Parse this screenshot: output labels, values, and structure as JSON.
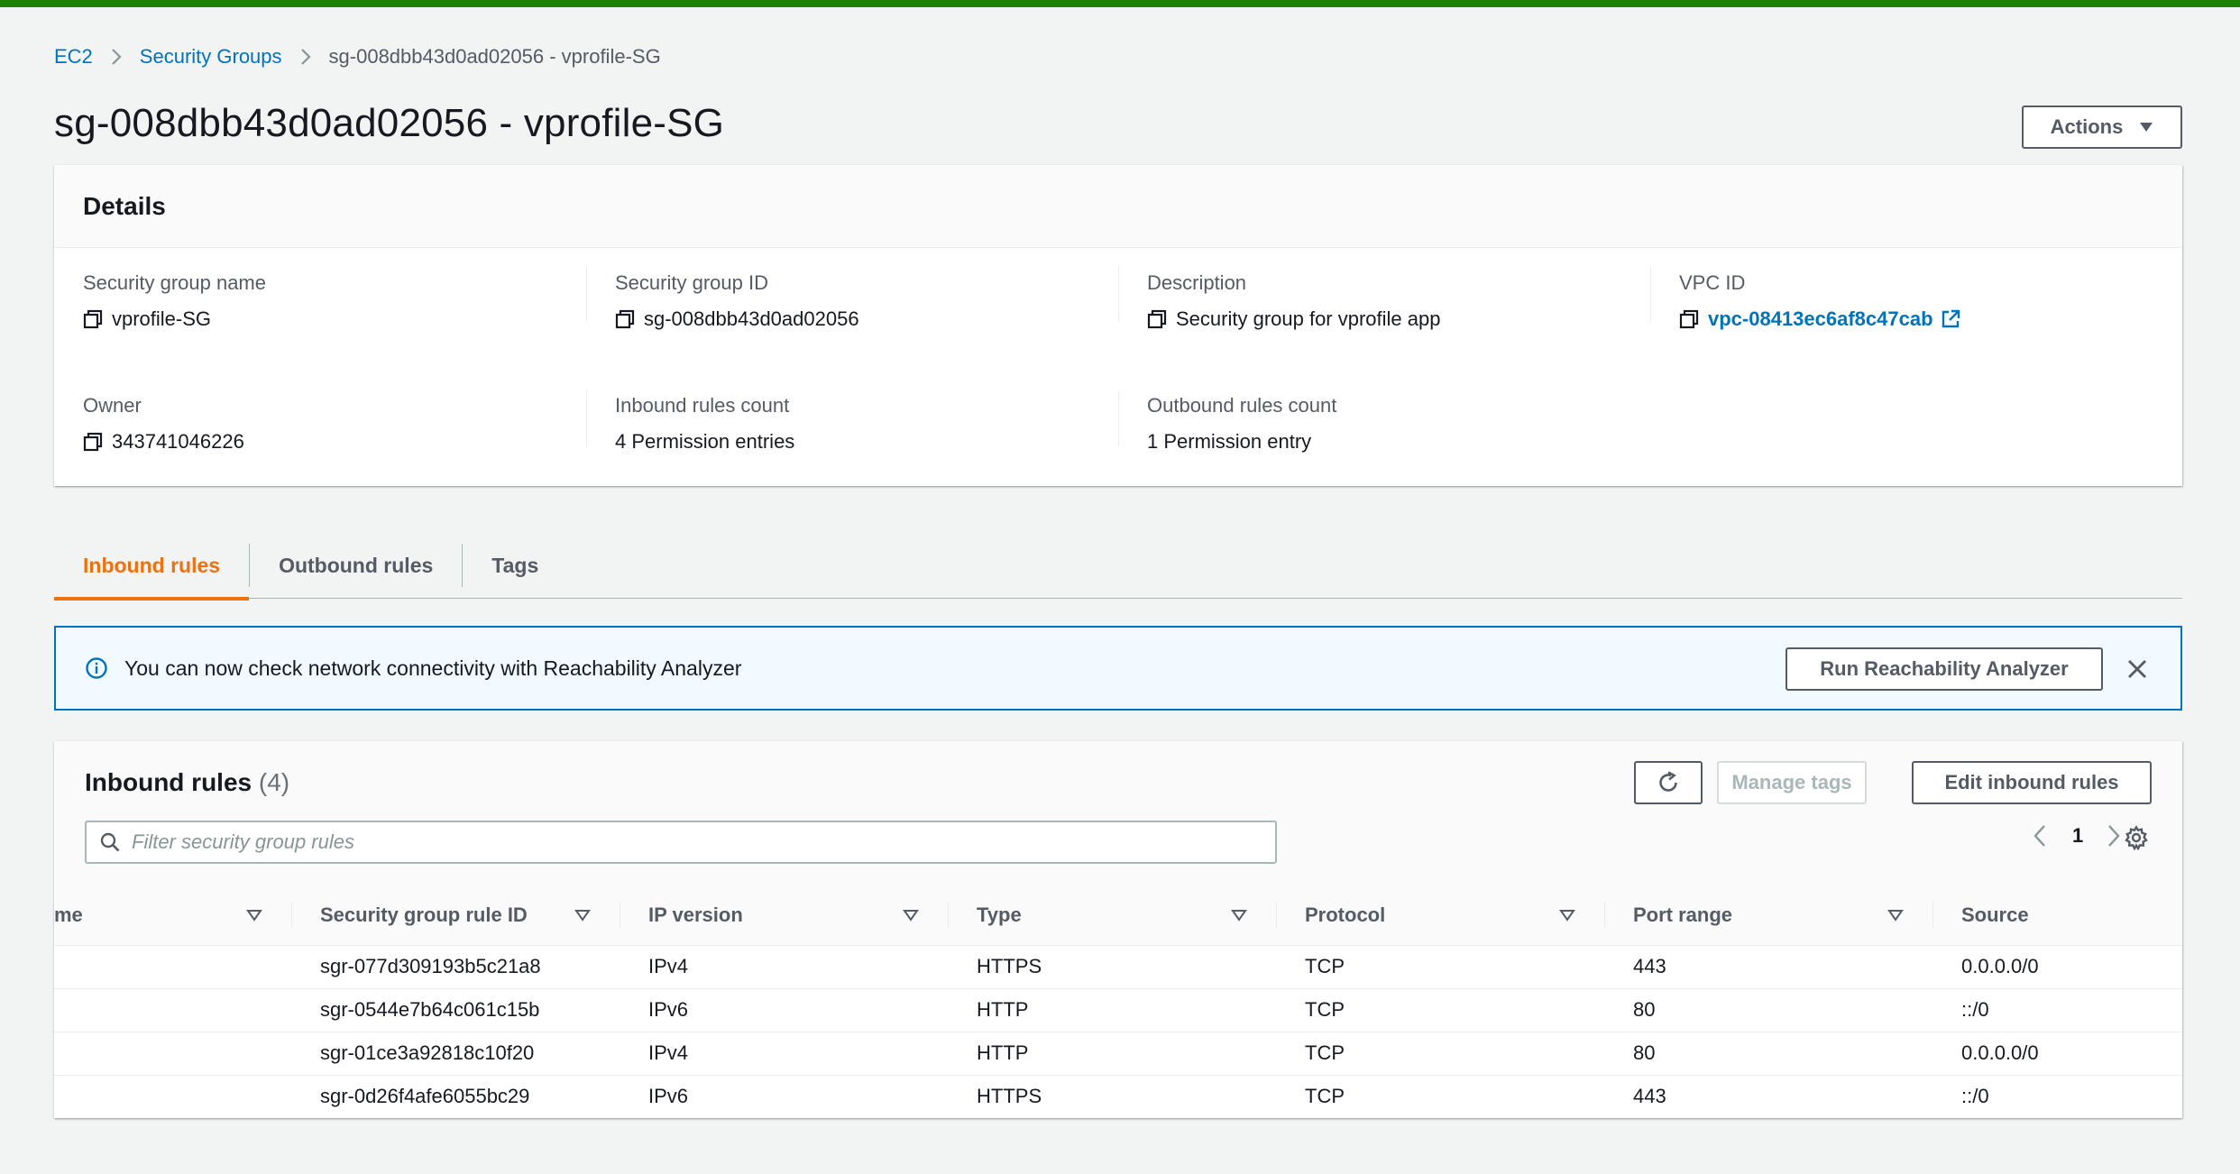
{
  "breadcrumb": {
    "items": [
      "EC2",
      "Security Groups"
    ],
    "current": "sg-008dbb43d0ad02056 - vprofile-SG"
  },
  "page_title": "sg-008dbb43d0ad02056 - vprofile-SG",
  "actions_label": "Actions",
  "details": {
    "title": "Details",
    "sg_name_label": "Security group name",
    "sg_name": "vprofile-SG",
    "sg_id_label": "Security group ID",
    "sg_id": "sg-008dbb43d0ad02056",
    "description_label": "Description",
    "description": "Security group for vprofile app",
    "vpc_id_label": "VPC ID",
    "vpc_id": "vpc-08413ec6af8c47cab",
    "owner_label": "Owner",
    "owner": "343741046226",
    "inbound_count_label": "Inbound rules count",
    "inbound_count": "4 Permission entries",
    "outbound_count_label": "Outbound rules count",
    "outbound_count": "1 Permission entry"
  },
  "tabs": [
    "Inbound rules",
    "Outbound rules",
    "Tags"
  ],
  "banner": {
    "message": "You can now check network connectivity with Reachability Analyzer",
    "button": "Run Reachability Analyzer"
  },
  "inbound": {
    "title": "Inbound rules",
    "count": "(4)",
    "manage_tags": "Manage tags",
    "edit_rules": "Edit inbound rules",
    "search_placeholder": "Filter security group rules",
    "page": "1",
    "columns": [
      "me",
      "Security group rule ID",
      "IP version",
      "Type",
      "Protocol",
      "Port range",
      "Source"
    ],
    "rows": [
      [
        "",
        "sgr-077d309193b5c21a8",
        "IPv4",
        "HTTPS",
        "TCP",
        "443",
        "0.0.0.0/0"
      ],
      [
        "",
        "sgr-0544e7b64c061c15b",
        "IPv6",
        "HTTP",
        "TCP",
        "80",
        "::/0"
      ],
      [
        "",
        "sgr-01ce3a92818c10f20",
        "IPv4",
        "HTTP",
        "TCP",
        "80",
        "0.0.0.0/0"
      ],
      [
        "",
        "sgr-0d26f4afe6055bc29",
        "IPv6",
        "HTTPS",
        "TCP",
        "443",
        "::/0"
      ]
    ]
  },
  "colors": {
    "accent_orange": "#ec7211",
    "link_blue": "#0073bb",
    "top_bar_green": "#1d8102"
  }
}
